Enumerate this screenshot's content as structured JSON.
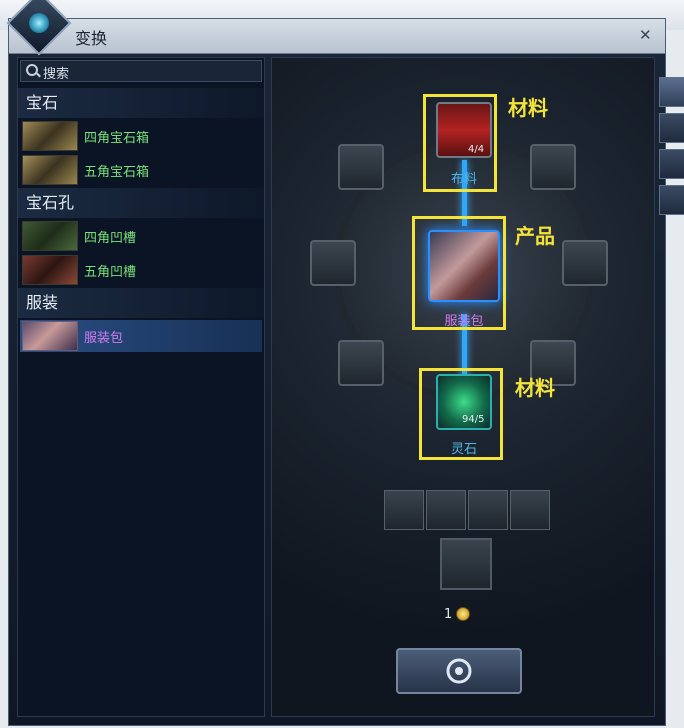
{
  "window": {
    "title": "变换",
    "close_glyph": "✕"
  },
  "search": {
    "label": "搜索"
  },
  "categories": [
    {
      "label": "宝石",
      "items": [
        {
          "label": "四角宝石箱"
        },
        {
          "label": "五角宝石箱"
        }
      ]
    },
    {
      "label": "宝石孔",
      "items": [
        {
          "label": "四角凹槽"
        },
        {
          "label": "五角凹槽"
        }
      ]
    },
    {
      "label": "服装",
      "items": [
        {
          "label": "服装包"
        }
      ]
    }
  ],
  "recipe": {
    "material_top": {
      "name": "布料",
      "qty": "4/4"
    },
    "product": {
      "name": "服装包"
    },
    "material_bottom": {
      "name": "灵石",
      "qty": "94/5"
    }
  },
  "annotations": {
    "material_1": "材料",
    "product": "产品",
    "material_2": "材料"
  },
  "footer": {
    "count": "1"
  },
  "side_tabs": [
    "pouch-icon",
    "gem-icon",
    "hexagon-icon",
    "outfit-icon"
  ],
  "colors": {
    "accent_beam": "#2ea7ff",
    "highlight": "#f4e43a",
    "green_item": "#7be07b",
    "purple_item": "#d37cf0"
  }
}
